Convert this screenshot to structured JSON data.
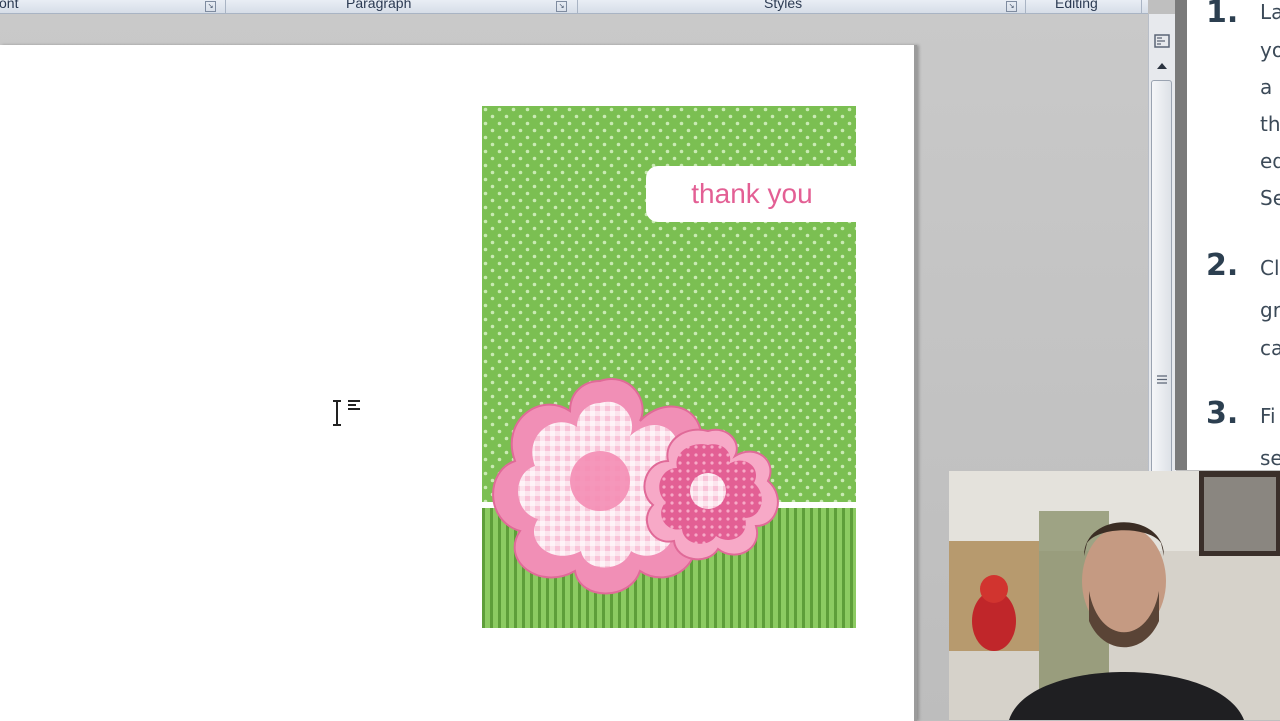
{
  "ribbon": {
    "groups": [
      {
        "name": "Font",
        "label": "ont"
      },
      {
        "name": "Paragraph",
        "label": "Paragraph"
      },
      {
        "name": "Styles",
        "label": "Styles"
      },
      {
        "name": "Editing",
        "label": "Editing"
      }
    ],
    "launcher_glyph": "↘"
  },
  "card": {
    "text": "thank you",
    "colors": {
      "green": "#7bbf52",
      "dot": "#c9eab3",
      "stripe_dark": "#5e9e3a",
      "pink": "#e35f94",
      "pink_light": "#f7a9c7",
      "label_bg": "#ffffff"
    }
  },
  "scrollbar": {
    "ruler_icon": "view-ruler-icon"
  },
  "instructions": {
    "items": [
      {
        "number": "1.",
        "lines": [
          "La",
          "yo",
          "a",
          "th",
          "ed",
          "Se"
        ]
      },
      {
        "number": "2.",
        "lines": [
          "Cl",
          "gr",
          "ca"
        ]
      },
      {
        "number": "3.",
        "lines": [
          "Fi",
          "se"
        ]
      }
    ]
  }
}
